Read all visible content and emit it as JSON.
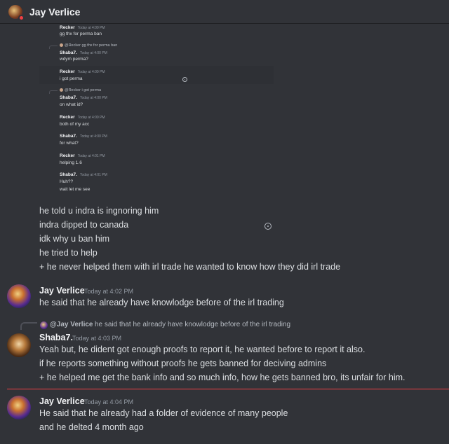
{
  "header": {
    "title": "Jay Verlice"
  },
  "embed": {
    "messages": [
      {
        "author": "Recker",
        "time": "Today at 4:00 PM",
        "text": "gg thx for perma ban",
        "reply": null
      },
      {
        "author": "Shaba7.",
        "time": "Today at 4:00 PM",
        "text": "wdym perma?",
        "reply": "@Recker gg thx for perma ban"
      },
      {
        "author": "Recker",
        "time": "Today at 4:00 PM",
        "text": "i got perma",
        "reply": null
      },
      {
        "author": "Shaba7.",
        "time": "Today at 4:00 PM",
        "text": "on what id?",
        "reply": "@Recker i got perma"
      },
      {
        "author": "Recker",
        "time": "Today at 4:00 PM",
        "text": "both of my acc",
        "reply": null
      },
      {
        "author": "Shaba7.",
        "time": "Today at 4:00 PM",
        "text": "for what?",
        "reply": null
      },
      {
        "author": "Recker",
        "time": "Today at 4:01 PM",
        "text": "helping 1.6",
        "reply": null
      },
      {
        "author": "Shaba7.",
        "time": "Today at 4:01 PM",
        "text": "Huh??",
        "text2": "wait let me see",
        "reply": null
      }
    ]
  },
  "continuation_lines": [
    "he told u indra is ingnoring him",
    "indra dipped to canada",
    "idk why u ban him",
    "he tried to help",
    "+ he never helped them with irl trade he wanted to know how they did irl trade"
  ],
  "msg1": {
    "author": "Jay Verlice",
    "time": "Today at 4:02 PM",
    "lines": [
      "he said that he already have knowlodge before of the irl trading"
    ]
  },
  "msg2": {
    "reply_author": "@Jay Verlice",
    "reply_text": "he said that he already have knowlodge before of the irl trading",
    "author": "Shaba7.",
    "time": "Today at 4:03 PM",
    "lines": [
      "Yeah but, he dident got enough proofs to report it, he wanted before to report it also.",
      "if he reports something without proofs he gets banned for deciving admins",
      "+ he helped me get the bank info and so much info, how he gets banned bro, its unfair for him."
    ]
  },
  "msg3": {
    "author": "Jay Verlice",
    "time": "Today at 4:04 PM",
    "lines": [
      "He said that he already had a folder of evidence of many people",
      "and he delted 4 month ago"
    ]
  },
  "icons": {
    "header_avatar": "avatar-icon",
    "status": "dnd-status-icon",
    "reaction": "add-reaction-icon"
  },
  "colors": {
    "background": "#313338",
    "text": "#dbdee1",
    "muted": "#949ba4",
    "new_messages_line": "#f23f43"
  }
}
